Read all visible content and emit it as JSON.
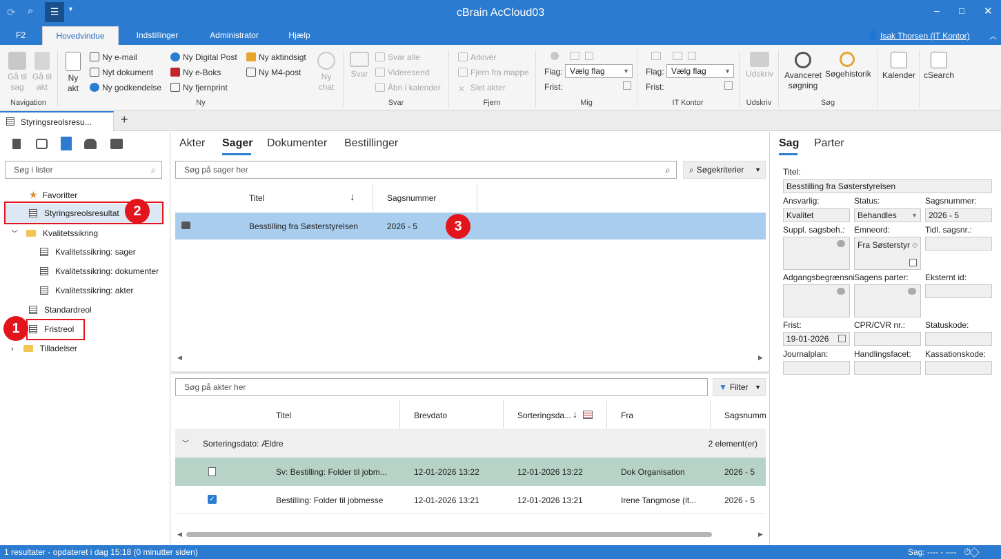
{
  "window": {
    "title": "cBrain AcCloud03"
  },
  "menu": {
    "tabs": [
      "F2",
      "Hovedvindue",
      "Indstillinger",
      "Administrator",
      "Hjælp"
    ],
    "user": "Isak Thorsen (IT Kontor)"
  },
  "ribbon": {
    "navigation": {
      "label": "Navigation",
      "goto_case": "Gå til sag",
      "goto_act": "Gå til akt"
    },
    "ny": {
      "label": "Ny",
      "new_act": "Ny akt",
      "email": "Ny e-mail",
      "document": "Nyt dokument",
      "approval": "Ny godkendelse",
      "digital_post": "Ny Digital Post",
      "eboks": "Ny e-Boks",
      "remote_print": "Ny fjernprint",
      "access_insight": "Ny aktindsigt",
      "m4_post": "Ny M4-post",
      "new_chat": "Ny chat"
    },
    "svar": {
      "label": "Svar",
      "reply": "Svar",
      "reply_all": "Svar alle",
      "forward": "Videresend",
      "open_calendar": "Åbn i kalender"
    },
    "fjern": {
      "label": "Fjern",
      "archive": "Arkivér",
      "remove_folder": "Fjern fra mappe",
      "delete_acts": "Slet akter"
    },
    "mig": {
      "label": "Mig",
      "flag_label": "Flag:",
      "flag_value": "Vælg flag",
      "deadline_label": "Frist:"
    },
    "it_kontor": {
      "label": "IT Kontor",
      "flag_label": "Flag:",
      "flag_value": "Vælg flag",
      "deadline_label": "Frist:"
    },
    "udskriv": {
      "label": "Udskriv",
      "print": "Udskriv"
    },
    "sog": {
      "label": "Søg",
      "advanced": "Avanceret søgning",
      "history": "Søgehistorik"
    },
    "calendar": "Kalender",
    "csearch": "cSearch"
  },
  "doc_tab": {
    "title": "Styringsreolsresu...",
    "add": "+"
  },
  "left": {
    "search_placeholder": "Søg i lister",
    "items": [
      "Favoritter",
      "Styringsreolsresultat",
      "Kvalitetssikring",
      "Kvalitetssikring: sager",
      "Kvalitetssikring: dokumenter",
      "Kvalitetssikring: akter",
      "Standardreol",
      "Fristreol",
      "Tilladelser"
    ]
  },
  "center": {
    "tabs": [
      "Akter",
      "Sager",
      "Dokumenter",
      "Bestillinger"
    ],
    "search_cases": "Søg på sager her",
    "criteria": "Søgekriterier",
    "case_cols": [
      "Titel",
      "Sagsnummer"
    ],
    "case_row": {
      "title": "Besstilling fra Søsterstyrelsen",
      "number": "2026 - 5"
    },
    "search_acts": "Søg på akter her",
    "filter": "Filter",
    "act_cols": [
      "Titel",
      "Brevdato",
      "Sorteringsda...",
      "Fra",
      "Sagsnumme"
    ],
    "group": {
      "label": "Sorteringsdato:  Ældre",
      "count": "2 element(er)"
    },
    "act_rows": [
      {
        "title": "Sv: Bestilling: Folder til jobm...",
        "date": "12-01-2026 13:22",
        "sort": "12-01-2026 13:22",
        "from": "Dok Organisation",
        "case": "2026 - 5"
      },
      {
        "title": "Bestilling: Folder til jobmesse",
        "date": "12-01-2026 13:21",
        "sort": "12-01-2026 13:21",
        "from": "Irene Tangmose (it...",
        "case": "2026 - 5"
      }
    ]
  },
  "right": {
    "tabs": [
      "Sag",
      "Parter"
    ],
    "title_label": "Titel:",
    "title_value": "Besstilling fra Søsterstyrelsen",
    "responsible_label": "Ansvarlig:",
    "responsible_value": "Kvalitet",
    "status_label": "Status:",
    "status_value": "Behandles",
    "case_no_label": "Sagsnummer:",
    "case_no_value": "2026 - 5",
    "suppl_label": "Suppl. sagsbeh.:",
    "keyword_label": "Emneord:",
    "keyword_value": "Fra Søsterstyr",
    "old_no_label": "Tidl. sagsnr.:",
    "access_label": "Adgangsbegrænsni",
    "parties_label": "Sagens parter:",
    "external_label": "Eksternt id:",
    "deadline_label": "Frist:",
    "deadline_value": "19-01-2026",
    "cpr_label": "CPR/CVR nr.:",
    "statuscode_label": "Statuskode:",
    "journal_label": "Journalplan:",
    "facet_label": "Handlingsfacet:",
    "disposal_label": "Kassationskode:"
  },
  "status": {
    "left": "1 resultater - opdateret i dag 15:18 (0 minutter siden)",
    "right": "Sag: ---- - ----"
  },
  "badges": [
    "1",
    "2",
    "3"
  ]
}
